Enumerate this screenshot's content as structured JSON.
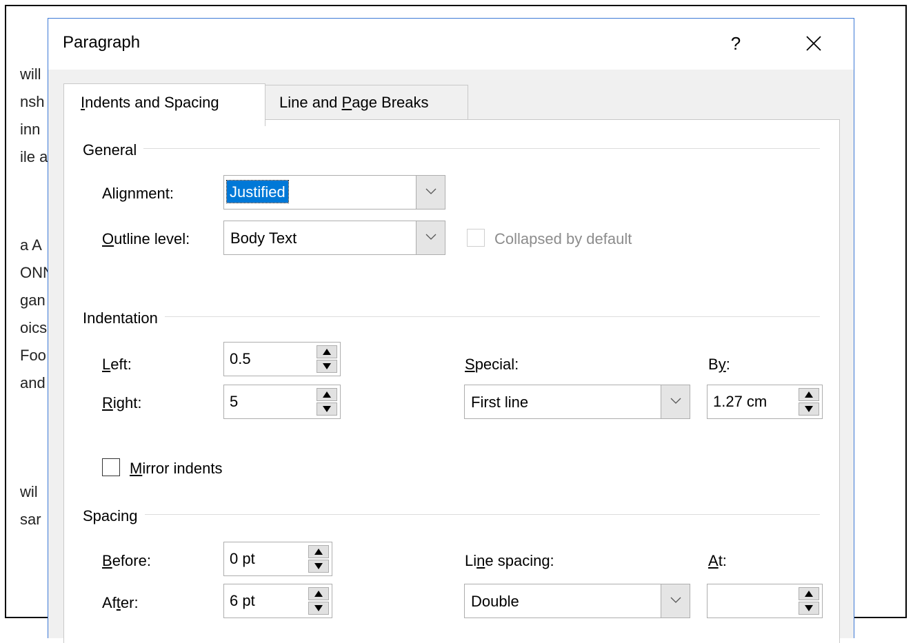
{
  "background_doc": {
    "lines": [
      "will",
      "nsh",
      "inn",
      "ile a",
      "a A",
      "ONN",
      "gan",
      "oics",
      "Foo",
      "and",
      "wil",
      "sar"
    ]
  },
  "dialog": {
    "title": "Paragraph",
    "help_label": "?",
    "accent_color": "#0078d7",
    "tabs": [
      {
        "pre": "",
        "mn": "I",
        "post": "ndents and Spacing",
        "active": true
      },
      {
        "pre": "Line and ",
        "mn": "P",
        "post": "age Breaks",
        "active": false
      }
    ],
    "general": {
      "title": "General",
      "alignment": {
        "pre": "Ali",
        "mn": "g",
        "post": "nment:",
        "value": "Justified"
      },
      "outline_level": {
        "pre": "",
        "mn": "O",
        "post": "utline level:",
        "value": "Body Text"
      },
      "collapsed": {
        "label": "Collapsed by default",
        "checked": false,
        "disabled": true
      }
    },
    "indentation": {
      "title": "Indentation",
      "left": {
        "pre": "",
        "mn": "L",
        "post": "eft:",
        "value": "0.5"
      },
      "right": {
        "pre": "",
        "mn": "R",
        "post": "ight:",
        "value": "5"
      },
      "special": {
        "pre": "",
        "mn": "S",
        "post": "pecial:",
        "value": "First line"
      },
      "by": {
        "pre": "B",
        "mn": "y",
        "post": ":",
        "value": "1.27 cm"
      },
      "mirror": {
        "pre": "",
        "mn": "M",
        "post": "irror indents",
        "checked": false
      }
    },
    "spacing": {
      "title": "Spacing",
      "before": {
        "pre": "",
        "mn": "B",
        "post": "efore:",
        "value": "0 pt"
      },
      "after": {
        "pre": "Af",
        "mn": "t",
        "post": "er:",
        "value": "6 pt"
      },
      "line_spacing": {
        "pre": "Li",
        "mn": "n",
        "post": "e spacing:",
        "value": "Double"
      },
      "at": {
        "pre": "",
        "mn": "A",
        "post": "t:",
        "value": ""
      }
    }
  }
}
